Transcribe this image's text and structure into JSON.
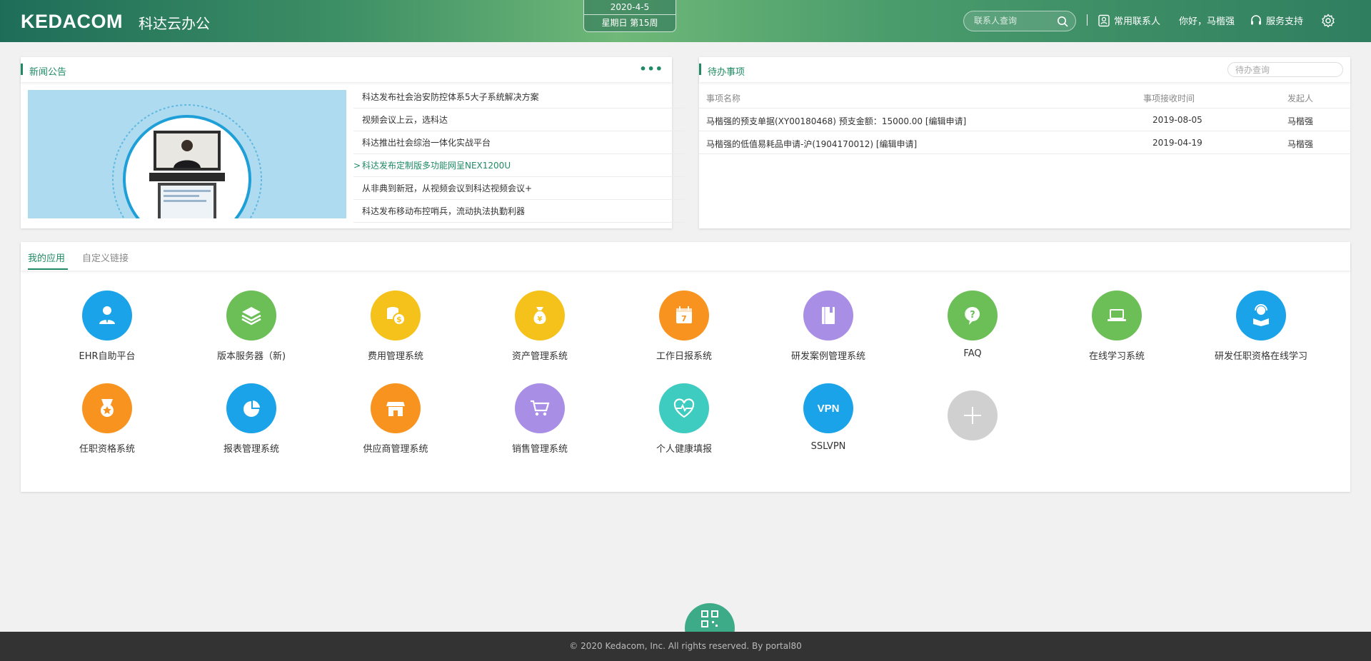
{
  "header": {
    "brand": "KEDACOM",
    "brand_sub": "科达云办公",
    "date": "2020-4-5",
    "weekday": "星期日 第15周",
    "contact_search_placeholder": "联系人查询",
    "contacts_label": "常用联系人",
    "greeting": "你好，马楷强",
    "support_label": "服务支持",
    "icons": [
      "search-icon",
      "contacts-icon",
      "headset-icon",
      "gear-icon"
    ]
  },
  "news": {
    "title": "新闻公告",
    "more": "•••",
    "items": [
      "科达发布社会治安防控体系5大子系统解决方案",
      "视频会议上云，选科达",
      "科达推出社会综治一体化实战平台",
      "科达发布定制版多功能网呈NEX1200U",
      "从非典到新冠，从视频会议到科达视频会议+",
      "科达发布移动布控哨兵，流动执法执勤利器"
    ],
    "active_index": 3,
    "active_caret": ">"
  },
  "todo": {
    "title": "待办事项",
    "search_placeholder": "待办查询",
    "columns": [
      "事项名称",
      "事项接收时间",
      "发起人"
    ],
    "rows": [
      {
        "name": "马楷强的预支单据(XY00180468) 预支金额：15000.00  [编辑申请]",
        "time": "2019-08-05",
        "sender": "马楷强"
      },
      {
        "name": "马楷强的低值易耗品申请-沪(1904170012)  [编辑申请]",
        "time": "2019-04-19",
        "sender": "马楷强"
      }
    ]
  },
  "apps": {
    "tabs": [
      "我的应用",
      "自定义链接"
    ],
    "items": [
      {
        "label": "EHR自助平台",
        "icon": "user-tie-icon",
        "color": "#1aa3e8"
      },
      {
        "label": "版本服务器（新)",
        "icon": "layers-icon",
        "color": "#6cbf56"
      },
      {
        "label": "费用管理系统",
        "icon": "coins-icon",
        "color": "#f5c21b"
      },
      {
        "label": "资产管理系统",
        "icon": "money-bag-icon",
        "color": "#f5c21b"
      },
      {
        "label": "工作日报系统",
        "icon": "calendar-icon",
        "color": "#f7931e"
      },
      {
        "label": "研发案例管理系统",
        "icon": "book-icon",
        "color": "#a98ee6"
      },
      {
        "label": "FAQ",
        "icon": "question-bubble-icon",
        "color": "#6cbf56"
      },
      {
        "label": "在线学习系统",
        "icon": "laptop-icon",
        "color": "#6cbf56"
      },
      {
        "label": "研发任职资格在线学习",
        "icon": "reader-icon",
        "color": "#1aa3e8"
      },
      {
        "label": "任职资格系统",
        "icon": "medal-icon",
        "color": "#f7931e"
      },
      {
        "label": "报表管理系统",
        "icon": "pie-chart-icon",
        "color": "#1aa3e8"
      },
      {
        "label": "供应商管理系统",
        "icon": "store-icon",
        "color": "#f7931e"
      },
      {
        "label": "销售管理系统",
        "icon": "cart-icon",
        "color": "#a98ee6"
      },
      {
        "label": "个人健康填报",
        "icon": "heart-pulse-icon",
        "color": "#3ecbc0"
      },
      {
        "label": "SSLVPN",
        "icon": "vpn-icon",
        "color": "#1aa3e8",
        "text": "VPN"
      }
    ],
    "add_icon": "plus-icon"
  },
  "footer": {
    "copyright": "© 2020 Kedacom, Inc. All rights reserved. By portal80"
  },
  "colors": {
    "brand_green": "#1f8a64",
    "footer_bg": "#333333"
  }
}
